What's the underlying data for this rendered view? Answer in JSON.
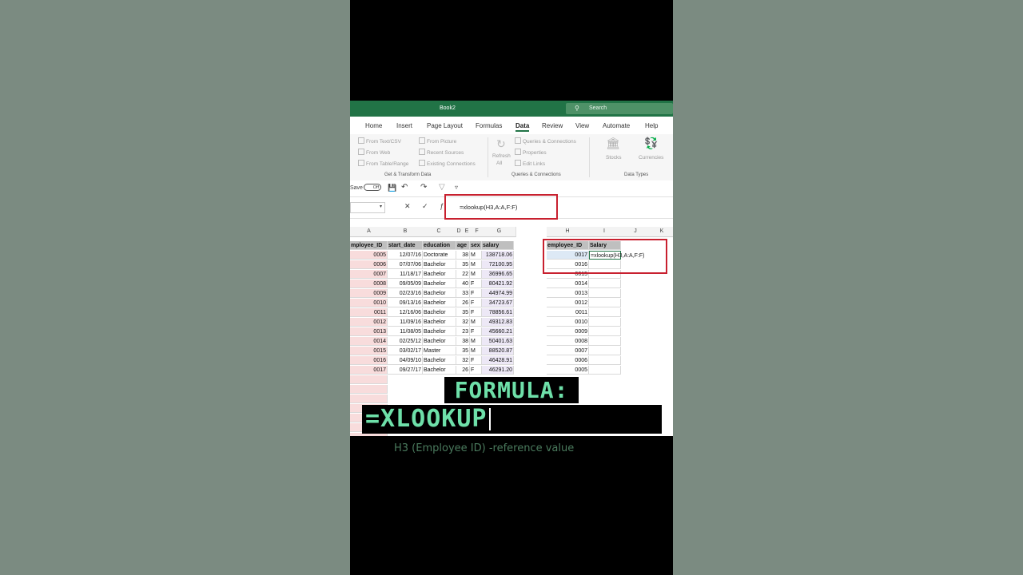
{
  "window": {
    "title": "Book2",
    "search_placeholder": "Search"
  },
  "tabs": [
    "Home",
    "Insert",
    "Page Layout",
    "Formulas",
    "Data",
    "Review",
    "View",
    "Automate",
    "Help"
  ],
  "active_tab": "Data",
  "ribbon": {
    "get_transform": [
      "From Text/CSV",
      "From Web",
      "From Table/Range"
    ],
    "get_transform_2": [
      "From Picture",
      "Recent Sources",
      "Existing Connections"
    ],
    "refresh": "Refresh",
    "refresh_all": "All",
    "queries": [
      "Queries & Connections",
      "Properties",
      "Edit Links"
    ],
    "data_types": [
      "Stocks",
      "Currencies"
    ],
    "group_labels": [
      "Get & Transform Data",
      "Queries & Connections",
      "Data Types"
    ]
  },
  "qat": {
    "autosave": "Save",
    "toggle": "Off"
  },
  "formula_bar": {
    "value": "=xlookup(H3,A:A,F:F)"
  },
  "columns": [
    "A",
    "B",
    "C",
    "D",
    "E",
    "F",
    "G",
    "H",
    "I",
    "J",
    "K"
  ],
  "table": {
    "headers": [
      "mployee_ID",
      "start_date",
      "education",
      "age",
      "sex",
      "salary"
    ],
    "rows": [
      [
        "0005",
        "12/07/16",
        "Doctorate",
        "38",
        "M",
        "138718.06"
      ],
      [
        "0006",
        "07/07/06",
        "Bachelor",
        "35",
        "M",
        "72100.95"
      ],
      [
        "0007",
        "11/18/17",
        "Bachelor",
        "22",
        "M",
        "36996.65"
      ],
      [
        "0008",
        "09/05/09",
        "Bachelor",
        "40",
        "F",
        "80421.92"
      ],
      [
        "0009",
        "02/23/16",
        "Bachelor",
        "33",
        "F",
        "44974.99"
      ],
      [
        "0010",
        "09/13/16",
        "Bachelor",
        "26",
        "F",
        "34723.67"
      ],
      [
        "0011",
        "12/16/06",
        "Bachelor",
        "35",
        "F",
        "78856.61"
      ],
      [
        "0012",
        "11/09/16",
        "Bachelor",
        "32",
        "M",
        "49312.83"
      ],
      [
        "0013",
        "11/08/05",
        "Bachelor",
        "23",
        "F",
        "45660.21"
      ],
      [
        "0014",
        "02/25/12",
        "Bachelor",
        "38",
        "M",
        "50401.63"
      ],
      [
        "0015",
        "03/02/17",
        "Master",
        "35",
        "M",
        "88520.87"
      ],
      [
        "0016",
        "04/09/10",
        "Bachelor",
        "32",
        "F",
        "46428.91"
      ],
      [
        "0017",
        "09/27/17",
        "Bachelor",
        "26",
        "F",
        "46291.20"
      ]
    ]
  },
  "lookup": {
    "headers": [
      "employee_ID",
      "Salary"
    ],
    "formula_cell": "=xlookup(H3,A:A,F:F)",
    "ids": [
      "0017",
      "0016",
      "0015",
      "0014",
      "0013",
      "0012",
      "0011",
      "0010",
      "0009",
      "0008",
      "0007",
      "0006",
      "0005"
    ]
  },
  "captions": {
    "heading": "FORMULA:",
    "typed": "=XLOOKUP",
    "sub": "H3 (Employee ID) -reference value"
  }
}
